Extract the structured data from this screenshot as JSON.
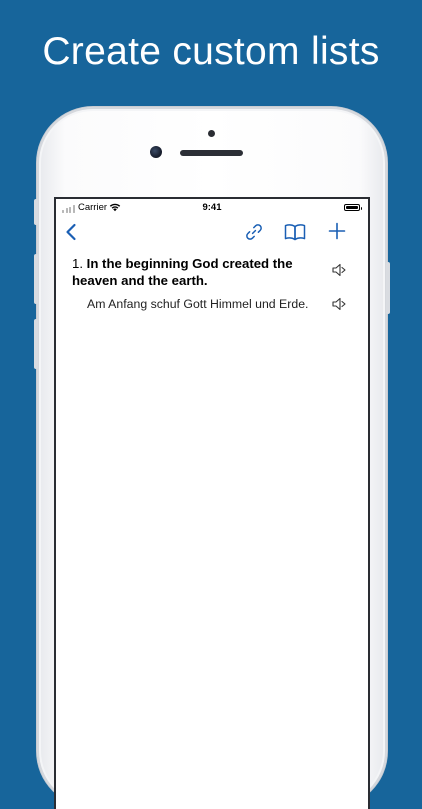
{
  "headline": "Create custom lists",
  "status_bar": {
    "carrier": "Carrier",
    "time": "9:41"
  },
  "nav": {
    "back_icon": "chevron-left-icon",
    "link_icon": "link-icon",
    "book_icon": "book-icon",
    "add_icon": "plus-icon",
    "accent_color": "#1a5fb4"
  },
  "entries": [
    {
      "number": "1.",
      "text": "In the beginning God created the heaven and the earth.",
      "translation": "Am Anfang schuf Gott Himmel und Erde."
    }
  ],
  "colors": {
    "background": "#17659b",
    "headline": "#ffffff"
  }
}
